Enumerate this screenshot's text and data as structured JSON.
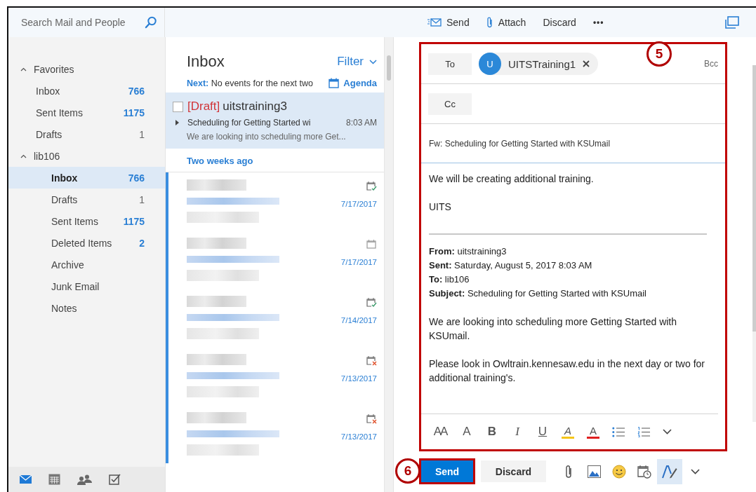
{
  "search": {
    "placeholder": "Search Mail and People"
  },
  "folders": [
    {
      "label": "Favorites",
      "kind": "favorites",
      "expanded": true,
      "children": [
        {
          "label": "Inbox",
          "count": "766",
          "count_unread": true,
          "selected": false
        },
        {
          "label": "Sent Items",
          "count": "1175",
          "count_unread": true,
          "selected": false
        },
        {
          "label": "Drafts",
          "count": "1",
          "count_unread": false,
          "selected": false
        }
      ]
    },
    {
      "label": "lib106",
      "kind": "account",
      "expanded": true,
      "children": [
        {
          "label": "Inbox",
          "count": "766",
          "count_unread": true,
          "selected": true
        },
        {
          "label": "Drafts",
          "count": "1",
          "count_unread": false,
          "selected": false
        },
        {
          "label": "Sent Items",
          "count": "1175",
          "count_unread": true,
          "selected": false
        },
        {
          "label": "Deleted Items",
          "count": "2",
          "count_unread": true,
          "selected": false
        },
        {
          "label": "Archive",
          "selected": false
        },
        {
          "label": "Junk Email",
          "selected": false
        },
        {
          "label": "Notes",
          "selected": false
        }
      ]
    }
  ],
  "nav": [
    {
      "kind": "mail",
      "selected": true
    },
    {
      "kind": "calendar",
      "selected": false
    },
    {
      "kind": "people",
      "selected": false
    },
    {
      "kind": "tasks",
      "selected": false
    }
  ],
  "toolbar": [
    {
      "kind": "send",
      "label": "Send"
    },
    {
      "kind": "attach",
      "label": "Attach"
    },
    {
      "kind": "discard",
      "label": "Discard"
    },
    {
      "kind": "more",
      "label": "•••"
    }
  ],
  "message_list": {
    "title": "Inbox",
    "filter": "Filter",
    "next_label": "Next:",
    "next_text": "No events for the next two",
    "agenda": "Agenda",
    "draft": {
      "tag": "[Draft]",
      "sender": "uitstraining3",
      "subject": "Scheduling for Getting Started wi",
      "time": "8:03 AM",
      "preview": "We are looking into scheduling more Get...",
      "selected": true,
      "checked": false
    },
    "group": "Two weeks ago",
    "items": [
      {
        "date": "7/17/2017",
        "kind": "accepted",
        "unread": true
      },
      {
        "date": "7/17/2017",
        "kind": "invite",
        "unread": true
      },
      {
        "date": "7/14/2017",
        "kind": "accepted",
        "unread": true
      },
      {
        "date": "7/13/2017",
        "kind": "declined",
        "unread": true
      },
      {
        "date": "7/13/2017",
        "kind": "declined",
        "unread": true
      }
    ]
  },
  "compose": {
    "to_label": "To",
    "recipients": [
      {
        "initial": "U",
        "name": "UITSTraining1"
      }
    ],
    "bcc": "Bcc",
    "cc_label": "Cc",
    "subject": "Fw: Scheduling for Getting Started with KSUmail",
    "body": [
      "We will be creating additional training.",
      "UITS"
    ],
    "header": [
      "**From:** uitstraining3",
      "**Sent:** Saturday, August 5, 2017 8:03 AM",
      "**To:** lib106",
      "**Subject:** Scheduling for Getting Started with KSUmail"
    ],
    "quoted": [
      "We are looking into scheduling more Getting Started with KSUmail.",
      "Please look in Owltrain.kennesaw.edu in the next day or two for additional training's."
    ],
    "format_tools": [
      {
        "kind": "font-size",
        "glyph": "AA"
      },
      {
        "kind": "grow",
        "glyph": "A"
      },
      {
        "kind": "bold",
        "glyph": "B"
      },
      {
        "kind": "italic",
        "glyph": "I"
      },
      {
        "kind": "underline",
        "glyph": "U"
      },
      {
        "kind": "highlight",
        "glyph": "A"
      },
      {
        "kind": "color",
        "glyph": "A"
      },
      {
        "kind": "bullets"
      },
      {
        "kind": "numbering"
      },
      {
        "kind": "more"
      }
    ],
    "send": "Send",
    "discard": "Discard",
    "actions": [
      {
        "kind": "attach",
        "selected": false
      },
      {
        "kind": "picture",
        "selected": false
      },
      {
        "kind": "emoji",
        "selected": false
      },
      {
        "kind": "schedule",
        "selected": false
      },
      {
        "kind": "pen",
        "selected": true
      },
      {
        "kind": "more",
        "selected": false
      }
    ]
  },
  "annotations": [
    {
      "number": "5"
    },
    {
      "number": "6"
    }
  ]
}
